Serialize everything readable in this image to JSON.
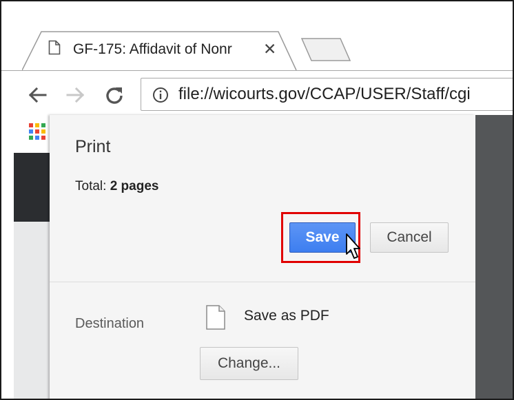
{
  "browser": {
    "tab": {
      "title": "GF-175: Affidavit of Nonr",
      "close_glyph": "✕",
      "page_icon": "page-icon"
    },
    "new_tab_icon": "new-tab-icon",
    "nav": {
      "back_icon": "back-arrow-icon",
      "forward_icon": "forward-arrow-icon",
      "reload_icon": "reload-icon"
    },
    "address_bar": {
      "icon": "info-icon",
      "url": "file://wicourts.gov/CCAP/USER/Staff/cgi"
    },
    "apps_icon": "apps-grid-icon"
  },
  "print_dialog": {
    "title": "Print",
    "total_label": "Total:",
    "total_value": "2 pages",
    "save_label": "Save",
    "cancel_label": "Cancel",
    "destination_label": "Destination",
    "destination_value": "Save as PDF",
    "change_label": "Change..."
  },
  "colors": {
    "save_button": "#3d7ef0",
    "highlight": "#e00000",
    "panel_background": "#f5f5f5"
  }
}
